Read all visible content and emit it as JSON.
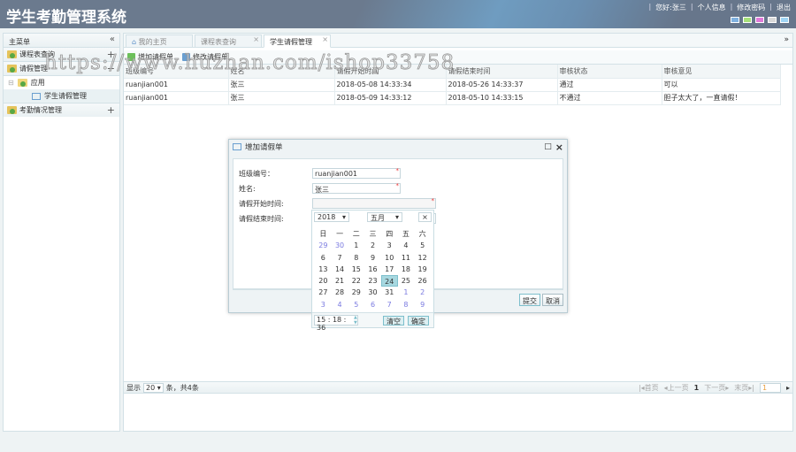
{
  "header": {
    "title": "学生考勤管理系统",
    "links": [
      "您好:张三",
      "个人信息",
      "修改密码",
      "退出"
    ],
    "theme_colors": [
      "#7fb1e0",
      "#a6e07a",
      "#e07ad9",
      "#d9d9d9",
      "#9fd5f5"
    ]
  },
  "sidebar": {
    "title": "主菜单",
    "collapse_icon": "«",
    "items": [
      {
        "label": "课程表查询",
        "toggle": "+"
      },
      {
        "label": "请假管理",
        "toggle": "−"
      }
    ],
    "tree": {
      "folder": "应用",
      "child": "学生请假管理"
    },
    "bottom": {
      "label": "考勤情况管理",
      "toggle": "+"
    }
  },
  "tabs": [
    {
      "label": "我的主页"
    },
    {
      "label": "课程表查询"
    },
    {
      "label": "学生请假管理"
    }
  ],
  "toolbar": {
    "add": "增加请假单",
    "edit": "修改请假单"
  },
  "table": {
    "headers": [
      "班级编号",
      "姓名",
      "请假开始时间",
      "请假结束时间",
      "审核状态",
      "审核意见"
    ],
    "rows": [
      [
        "ruanjian001",
        "张三",
        "2018-05-08 14:33:34",
        "2018-05-26 14:33:37",
        "通过",
        "可以"
      ],
      [
        "ruanjian001",
        "张三",
        "2018-05-09 14:33:12",
        "2018-05-10 14:33:15",
        "不通过",
        "胆子太大了，一直请假！"
      ]
    ]
  },
  "pager": {
    "show": "显示",
    "page_size": "20",
    "summary": "条，共4条",
    "first": "首页",
    "prev": "上一页",
    "current": "1",
    "next": "下一页",
    "last": "末页",
    "goto": "1"
  },
  "dialog": {
    "title": "增加请假单",
    "fields": [
      {
        "label": "班级编号：",
        "value": "ruanjian001"
      },
      {
        "label": "姓名:",
        "value": "张三"
      },
      {
        "label": "请假开始时间:",
        "value": ""
      },
      {
        "label": "请假结束时间:",
        "value": ""
      }
    ],
    "submit": "提交",
    "cancel": "取消"
  },
  "calendar": {
    "year": "2018",
    "month": "五月",
    "close": "×",
    "weekdays": [
      "日",
      "一",
      "二",
      "三",
      "四",
      "五",
      "六"
    ],
    "days": [
      "29",
      "30",
      "1",
      "2",
      "3",
      "4",
      "5",
      "6",
      "7",
      "8",
      "9",
      "10",
      "11",
      "12",
      "13",
      "14",
      "15",
      "16",
      "17",
      "18",
      "19",
      "20",
      "21",
      "22",
      "23",
      "24",
      "25",
      "26",
      "27",
      "28",
      "29",
      "30",
      "31",
      "1",
      "2",
      "3",
      "4",
      "5",
      "6",
      "7",
      "8",
      "9"
    ],
    "today": "24",
    "time": "15 : 18 : 36",
    "clear": "清空",
    "ok": "确定"
  },
  "watermark": "https://www.huzhan.com/ishop33758"
}
